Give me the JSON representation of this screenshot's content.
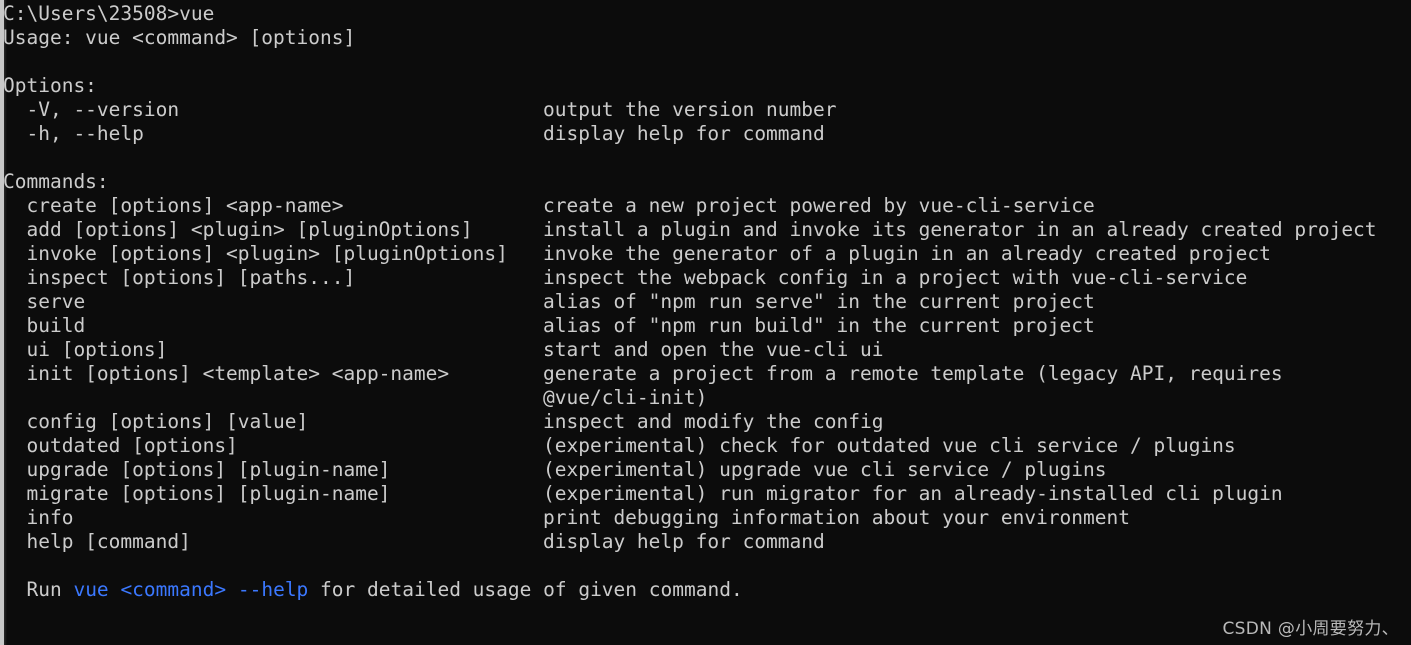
{
  "terminal": {
    "background_color": "#0c0c0c",
    "foreground_color": "#cccccc",
    "accent_color": "#3b78ff",
    "prompt_line": "C:\\Users\\23508>vue",
    "usage_line": "Usage: vue <command> [options]",
    "options_header": "Options:",
    "options": [
      {
        "flags": "  -V, --version",
        "description": "output the version number"
      },
      {
        "flags": "  -h, --help",
        "description": "display help for command"
      }
    ],
    "commands_header": "Commands:",
    "commands": [
      {
        "syntax": "  create [options] <app-name>",
        "description": "create a new project powered by vue-cli-service"
      },
      {
        "syntax": "  add [options] <plugin> [pluginOptions]",
        "description": "install a plugin and invoke its generator in an already created project"
      },
      {
        "syntax": "  invoke [options] <plugin> [pluginOptions]",
        "description": "invoke the generator of a plugin in an already created project"
      },
      {
        "syntax": "  inspect [options] [paths...]",
        "description": "inspect the webpack config in a project with vue-cli-service"
      },
      {
        "syntax": "  serve",
        "description": "alias of \"npm run serve\" in the current project"
      },
      {
        "syntax": "  build",
        "description": "alias of \"npm run build\" in the current project"
      },
      {
        "syntax": "  ui [options]",
        "description": "start and open the vue-cli ui"
      },
      {
        "syntax": "  init [options] <template> <app-name>",
        "description": "generate a project from a remote template (legacy API, requires"
      },
      {
        "syntax": "",
        "description": "@vue/cli-init)"
      },
      {
        "syntax": "  config [options] [value]",
        "description": "inspect and modify the config"
      },
      {
        "syntax": "  outdated [options]",
        "description": "(experimental) check for outdated vue cli service / plugins"
      },
      {
        "syntax": "  upgrade [options] [plugin-name]",
        "description": "(experimental) upgrade vue cli service / plugins"
      },
      {
        "syntax": "  migrate [options] [plugin-name]",
        "description": "(experimental) run migrator for an already-installed cli plugin"
      },
      {
        "syntax": "  info",
        "description": "print debugging information about your environment"
      },
      {
        "syntax": "  help [command]",
        "description": "display help for command"
      }
    ],
    "footer": {
      "prefix": "  Run ",
      "accent_1": "vue",
      "sep_1": " ",
      "accent_2": "<command>",
      "sep_2": " ",
      "accent_3": "--help",
      "suffix": " for detailed usage of given command."
    }
  },
  "watermark": {
    "text": "CSDN @小周要努力、"
  }
}
